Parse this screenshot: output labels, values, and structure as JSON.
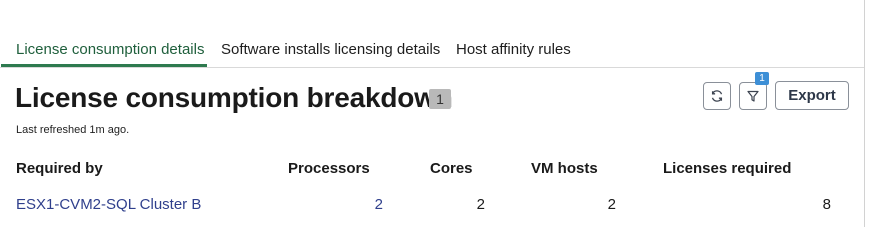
{
  "tabs": [
    {
      "label": "License consumption details",
      "active": true
    },
    {
      "label": "Software installs licensing details",
      "active": false
    },
    {
      "label": "Host affinity rules",
      "active": false
    }
  ],
  "header": {
    "title": "License consumption breakdown",
    "count": "1",
    "last_refreshed": "Last refreshed 1m ago."
  },
  "toolbar": {
    "refresh_icon": "refresh-icon",
    "filter_icon": "filter-icon",
    "filter_count": "1",
    "export_label": "Export"
  },
  "table": {
    "columns": [
      "Required by",
      "Processors",
      "Cores",
      "VM hosts",
      "Licenses required"
    ],
    "rows": [
      {
        "required_by": "ESX1-CVM2-SQL Cluster B",
        "processors": "2",
        "cores": "2",
        "vm_hosts": "2",
        "licenses_required": "8"
      }
    ]
  },
  "colors": {
    "accent_green": "#2e7a4f",
    "link_blue": "#2f3f8c",
    "badge_blue": "#3d8fd6",
    "badge_gray": "#b9b9b9"
  }
}
